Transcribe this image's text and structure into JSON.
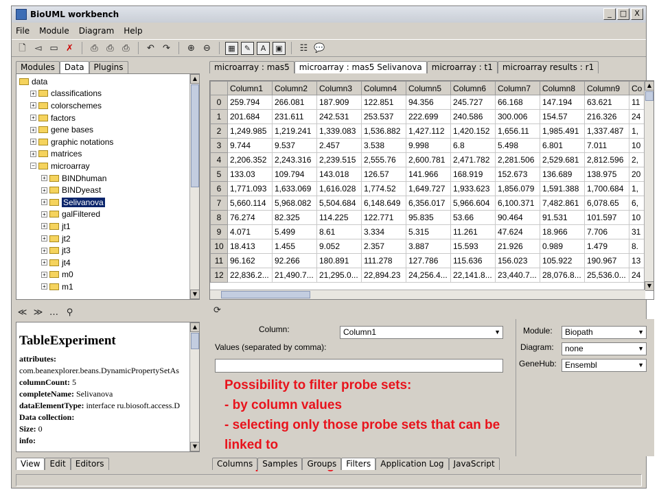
{
  "window": {
    "title": "BioUML workbench",
    "buttons": [
      "_",
      "□",
      "X"
    ]
  },
  "menu": [
    "File",
    "Module",
    "Diagram",
    "Help"
  ],
  "left_tabs": [
    "Modules",
    "Data",
    "Plugins"
  ],
  "left_active_tab": "Data",
  "tree": [
    {
      "label": "data",
      "indent": 0,
      "expanded": true
    },
    {
      "label": "classifications",
      "indent": 1
    },
    {
      "label": "colorschemes",
      "indent": 1
    },
    {
      "label": "factors",
      "indent": 1
    },
    {
      "label": "gene bases",
      "indent": 1
    },
    {
      "label": "graphic notations",
      "indent": 1
    },
    {
      "label": "matrices",
      "indent": 1
    },
    {
      "label": "microarray",
      "indent": 1,
      "expanded": true
    },
    {
      "label": "BINDhuman",
      "indent": 2
    },
    {
      "label": "BINDyeast",
      "indent": 2
    },
    {
      "label": "Selivanova",
      "indent": 2,
      "selected": true
    },
    {
      "label": "galFiltered",
      "indent": 2
    },
    {
      "label": "jt1",
      "indent": 2
    },
    {
      "label": "jt2",
      "indent": 2
    },
    {
      "label": "jt3",
      "indent": 2
    },
    {
      "label": "jt4",
      "indent": 2
    },
    {
      "label": "m0",
      "indent": 2
    },
    {
      "label": "m1",
      "indent": 2
    }
  ],
  "doc_tabs": [
    "microarray : mas5",
    "microarray : mas5 Selivanova",
    "microarray : t1",
    "microarray results : r1"
  ],
  "doc_active_tab": "microarray : mas5 Selivanova",
  "table": {
    "columns": [
      "Column1",
      "Column2",
      "Column3",
      "Column4",
      "Column5",
      "Column6",
      "Column7",
      "Column8",
      "Column9",
      "Co"
    ],
    "rows": [
      [
        "0",
        "259.794",
        "266.081",
        "187.909",
        "122.851",
        "94.356",
        "245.727",
        "66.168",
        "147.194",
        "63.621",
        "11"
      ],
      [
        "1",
        "201.684",
        "231.611",
        "242.531",
        "253.537",
        "222.699",
        "240.586",
        "300.006",
        "154.57",
        "216.326",
        "24"
      ],
      [
        "2",
        "1,249.985",
        "1,219.241",
        "1,339.083",
        "1,536.882",
        "1,427.112",
        "1,420.152",
        "1,656.11",
        "1,985.491",
        "1,337.487",
        "1,"
      ],
      [
        "3",
        "9.744",
        "9.537",
        "2.457",
        "3.538",
        "9.998",
        "6.8",
        "5.498",
        "6.801",
        "7.011",
        "10"
      ],
      [
        "4",
        "2,206.352",
        "2,243.316",
        "2,239.515",
        "2,555.76",
        "2,600.781",
        "2,471.782",
        "2,281.506",
        "2,529.681",
        "2,812.596",
        "2,"
      ],
      [
        "5",
        "133.03",
        "109.794",
        "143.018",
        "126.57",
        "141.966",
        "168.919",
        "152.673",
        "136.689",
        "138.975",
        "20"
      ],
      [
        "6",
        "1,771.093",
        "1,633.069",
        "1,616.028",
        "1,774.52",
        "1,649.727",
        "1,933.623",
        "1,856.079",
        "1,591.388",
        "1,700.684",
        "1,"
      ],
      [
        "7",
        "5,660.114",
        "5,968.082",
        "5,504.684",
        "6,148.649",
        "6,356.017",
        "5,966.604",
        "6,100.371",
        "7,482.861",
        "6,078.65",
        "6,"
      ],
      [
        "8",
        "76.274",
        "82.325",
        "114.225",
        "122.771",
        "95.835",
        "53.66",
        "90.464",
        "91.531",
        "101.597",
        "10"
      ],
      [
        "9",
        "4.071",
        "5.499",
        "8.61",
        "3.334",
        "5.315",
        "11.261",
        "47.624",
        "18.966",
        "7.706",
        "31"
      ],
      [
        "10",
        "18.413",
        "1.455",
        "9.052",
        "2.357",
        "3.887",
        "15.593",
        "21.926",
        "0.989",
        "1.479",
        "8."
      ],
      [
        "11",
        "96.162",
        "92.266",
        "180.891",
        "111.278",
        "127.786",
        "115.636",
        "156.023",
        "105.922",
        "190.967",
        "13"
      ],
      [
        "12",
        "22,836.2...",
        "21,490.7...",
        "21,295.0...",
        "22,894.23",
        "24,256.4...",
        "22,141.8...",
        "23,440.7...",
        "28,076.8...",
        "25,536.0...",
        "24"
      ]
    ]
  },
  "properties": {
    "title": "TableExperiment",
    "lines": [
      {
        "key": "attributes:",
        "value": ""
      },
      {
        "key": "",
        "value": "com.beanexplorer.beans.DynamicPropertySetAs"
      },
      {
        "key": "columnCount:",
        "value": "5"
      },
      {
        "key": "completeName:",
        "value": "Selivanova"
      },
      {
        "key": "dataElementType:",
        "value": "interface ru.biosoft.access.D"
      },
      {
        "key": "Data collection:",
        "value": ""
      },
      {
        "key": "  Size:",
        "value": "0"
      },
      {
        "key": "info:",
        "value": ""
      }
    ]
  },
  "left_bottom_tabs": [
    "View",
    "Edit",
    "Editors"
  ],
  "filter": {
    "column_label": "Column:",
    "column_value": "Column1",
    "values_label": "Values (separated by comma):",
    "module_label": "Module:",
    "module_value": "Biopath",
    "diagram_label": "Diagram:",
    "diagram_value": "none",
    "genehub_label": "GeneHub:",
    "genehub_value": "Ensembl"
  },
  "note_lines": [
    "Possibility to filter probe sets:",
    "- by column values",
    "- selecting only those probe sets that can be linked to",
    "the specified diagram"
  ],
  "bottom_tabs": [
    "Columns",
    "Samples",
    "Groups",
    "Filters",
    "Application Log",
    "JavaScript"
  ],
  "bottom_active_tab": "Filters",
  "colors": {
    "note": "#e8131c",
    "selection": "#0a246a",
    "chrome": "#d4d0c8"
  }
}
